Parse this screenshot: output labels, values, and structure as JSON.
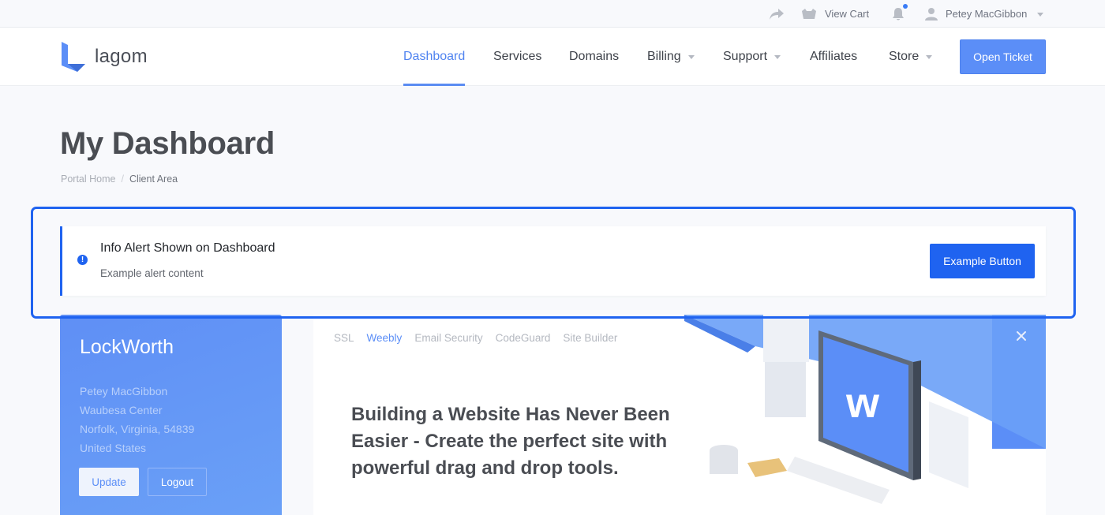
{
  "topbar": {
    "view_cart": "View Cart",
    "user_name": "Petey MacGibbon"
  },
  "header": {
    "logo_text": "lagom",
    "nav": [
      {
        "label": "Dashboard",
        "active": true,
        "dropdown": false
      },
      {
        "label": "Services",
        "active": false,
        "dropdown": false
      },
      {
        "label": "Domains",
        "active": false,
        "dropdown": false
      },
      {
        "label": "Billing",
        "active": false,
        "dropdown": true
      },
      {
        "label": "Support",
        "active": false,
        "dropdown": true
      },
      {
        "label": "Affiliates",
        "active": false,
        "dropdown": false
      },
      {
        "label": "Store",
        "active": false,
        "dropdown": true
      }
    ],
    "open_ticket": "Open Ticket"
  },
  "page": {
    "title": "My Dashboard",
    "breadcrumb": [
      "Portal Home",
      "Client Area"
    ]
  },
  "alert": {
    "title": "Info Alert Shown on Dashboard",
    "body": "Example alert content",
    "button": "Example Button"
  },
  "client": {
    "name": "LockWorth",
    "address": [
      "Petey MacGibbon",
      "Waubesa Center",
      "Norfolk, Virginia, 54839",
      "United States"
    ],
    "update": "Update",
    "logout": "Logout"
  },
  "promo": {
    "tabs": [
      {
        "label": "SSL",
        "active": false
      },
      {
        "label": "Weebly",
        "active": true
      },
      {
        "label": "Email Security",
        "active": false
      },
      {
        "label": "CodeGuard",
        "active": false
      },
      {
        "label": "Site Builder",
        "active": false
      }
    ],
    "headline": "Building a Website Has Never Been Easier - Create the perfect site with powerful drag and drop tools."
  },
  "colors": {
    "accent": "#5b8ef7",
    "alert": "#1f63f0"
  }
}
